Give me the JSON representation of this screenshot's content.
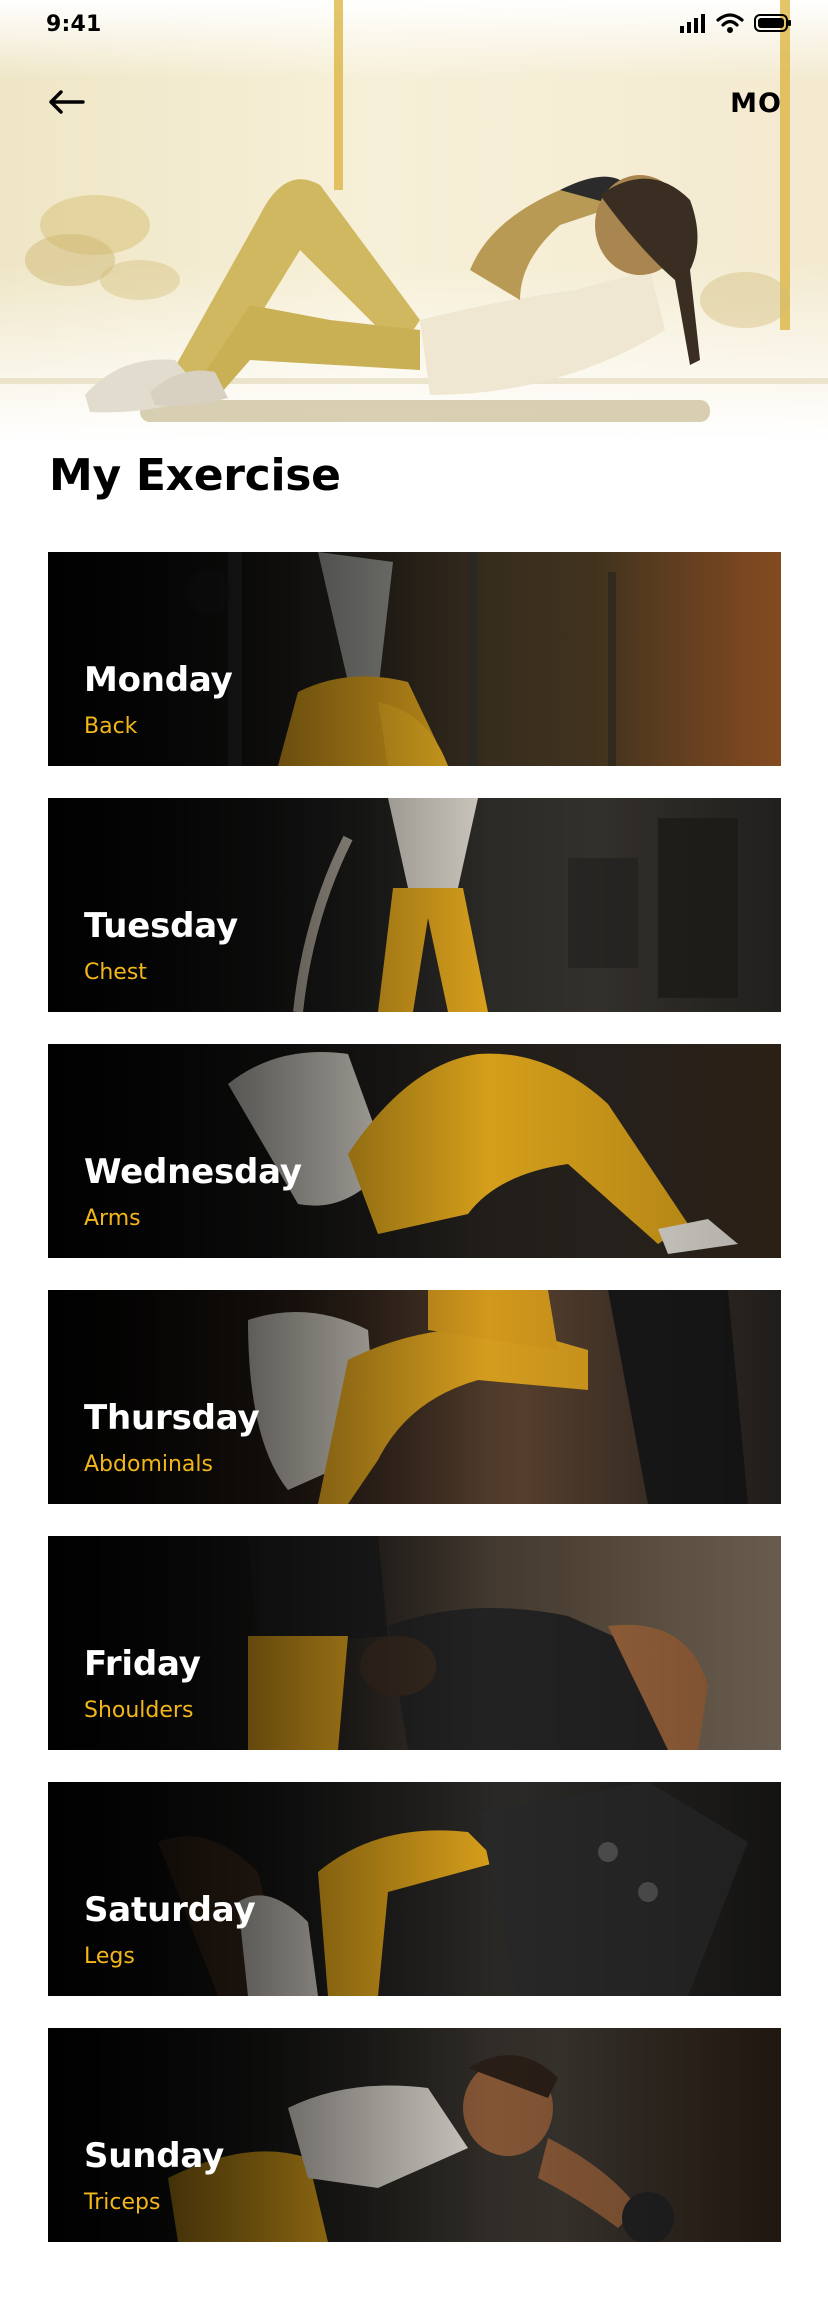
{
  "status_bar": {
    "time": "9:41",
    "icons": [
      "signal-icon",
      "wifi-icon",
      "battery-icon"
    ]
  },
  "header": {
    "back_icon": "arrow-left-icon",
    "avatar_initials": "MO"
  },
  "page": {
    "title": "My Exercise"
  },
  "colors": {
    "accent": "#f2b61a",
    "card_text": "#ffffff",
    "background": "#ffffff"
  },
  "exercises": [
    {
      "day": "Monday",
      "muscle": "Back"
    },
    {
      "day": "Tuesday",
      "muscle": "Chest"
    },
    {
      "day": "Wednesday",
      "muscle": "Arms"
    },
    {
      "day": "Thursday",
      "muscle": "Abdominals"
    },
    {
      "day": "Friday",
      "muscle": "Shoulders"
    },
    {
      "day": "Saturday",
      "muscle": "Legs"
    },
    {
      "day": "Sunday",
      "muscle": "Triceps"
    }
  ]
}
